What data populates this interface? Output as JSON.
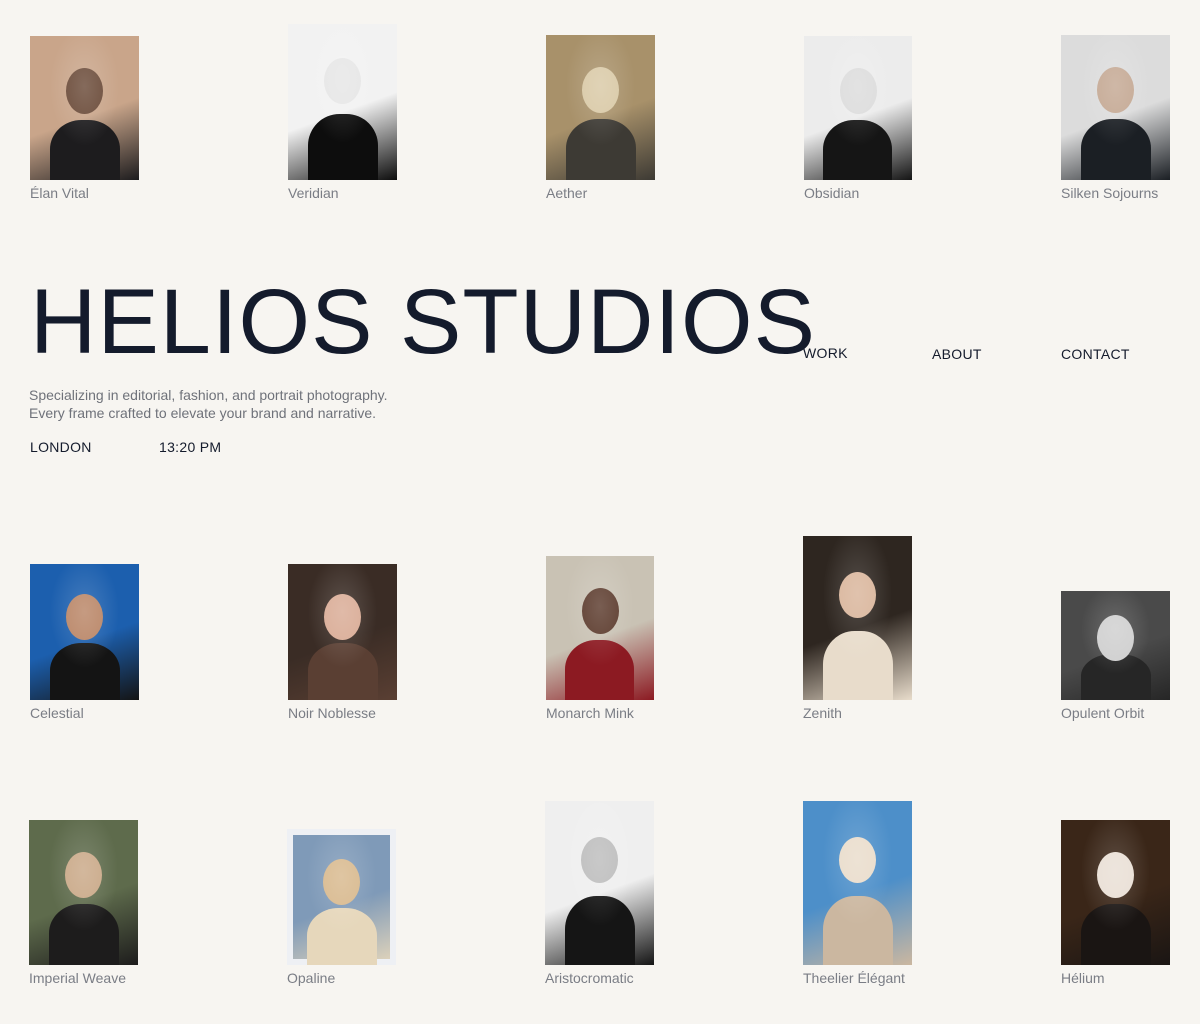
{
  "brand": {
    "name": "HELIOS STUDIOS",
    "tagline_line1": "Specializing in editorial, fashion, and portrait photography.",
    "tagline_line2": "Every frame crafted to elevate your brand and narrative.",
    "location": "LONDON",
    "time": "13:20 PM"
  },
  "nav": {
    "work": "WORK",
    "about": "ABOUT",
    "contact": "CONTACT"
  },
  "gallery": [
    {
      "title": "Élan Vital",
      "colors": [
        "#c9a58a",
        "#6a4a38",
        "#1d1c1e"
      ]
    },
    {
      "title": "Veridian",
      "colors": [
        "#f2f2f2",
        "#e6e6e6",
        "#0d0d0d"
      ]
    },
    {
      "title": "Aether",
      "colors": [
        "#a8916a",
        "#d9c9a6",
        "#3d3a34"
      ]
    },
    {
      "title": "Obsidian",
      "colors": [
        "#ececec",
        "#dcdcdc",
        "#151515"
      ]
    },
    {
      "title": "Silken Sojourns",
      "colors": [
        "#dcdcdc",
        "#c4a893",
        "#1b1f24"
      ]
    },
    {
      "title": "Celestial",
      "colors": [
        "#1c5fae",
        "#b98566",
        "#141414"
      ]
    },
    {
      "title": "Noir Noblesse",
      "colors": [
        "#3a2c25",
        "#d9ab95",
        "#5a3f33"
      ]
    },
    {
      "title": "Monarch Mink",
      "colors": [
        "#c9c2b4",
        "#5b3a2c",
        "#8c1a22"
      ]
    },
    {
      "title": "Zenith",
      "colors": [
        "#2e2620",
        "#d9b59b",
        "#e8dccb"
      ]
    },
    {
      "title": "Opulent Orbit",
      "colors": [
        "#4a4a4a",
        "#cfcfcf",
        "#262626"
      ]
    },
    {
      "title": "Imperial Weave",
      "colors": [
        "#5e6b4c",
        "#c9a887",
        "#1d1c1c"
      ]
    },
    {
      "title": "Opaline",
      "colors": [
        "#7f9ab8",
        "#d8b98e",
        "#e6d7bb"
      ]
    },
    {
      "title": "Aristocromatic",
      "colors": [
        "#efefef",
        "#bdbdbd",
        "#151515"
      ]
    },
    {
      "title": "Theelier Élégant",
      "colors": [
        "#4d8fc9",
        "#e9dccb",
        "#cbb7a0"
      ]
    },
    {
      "title": "Hélium",
      "colors": [
        "#3a2618",
        "#e9dfd5",
        "#1a1513"
      ]
    }
  ]
}
